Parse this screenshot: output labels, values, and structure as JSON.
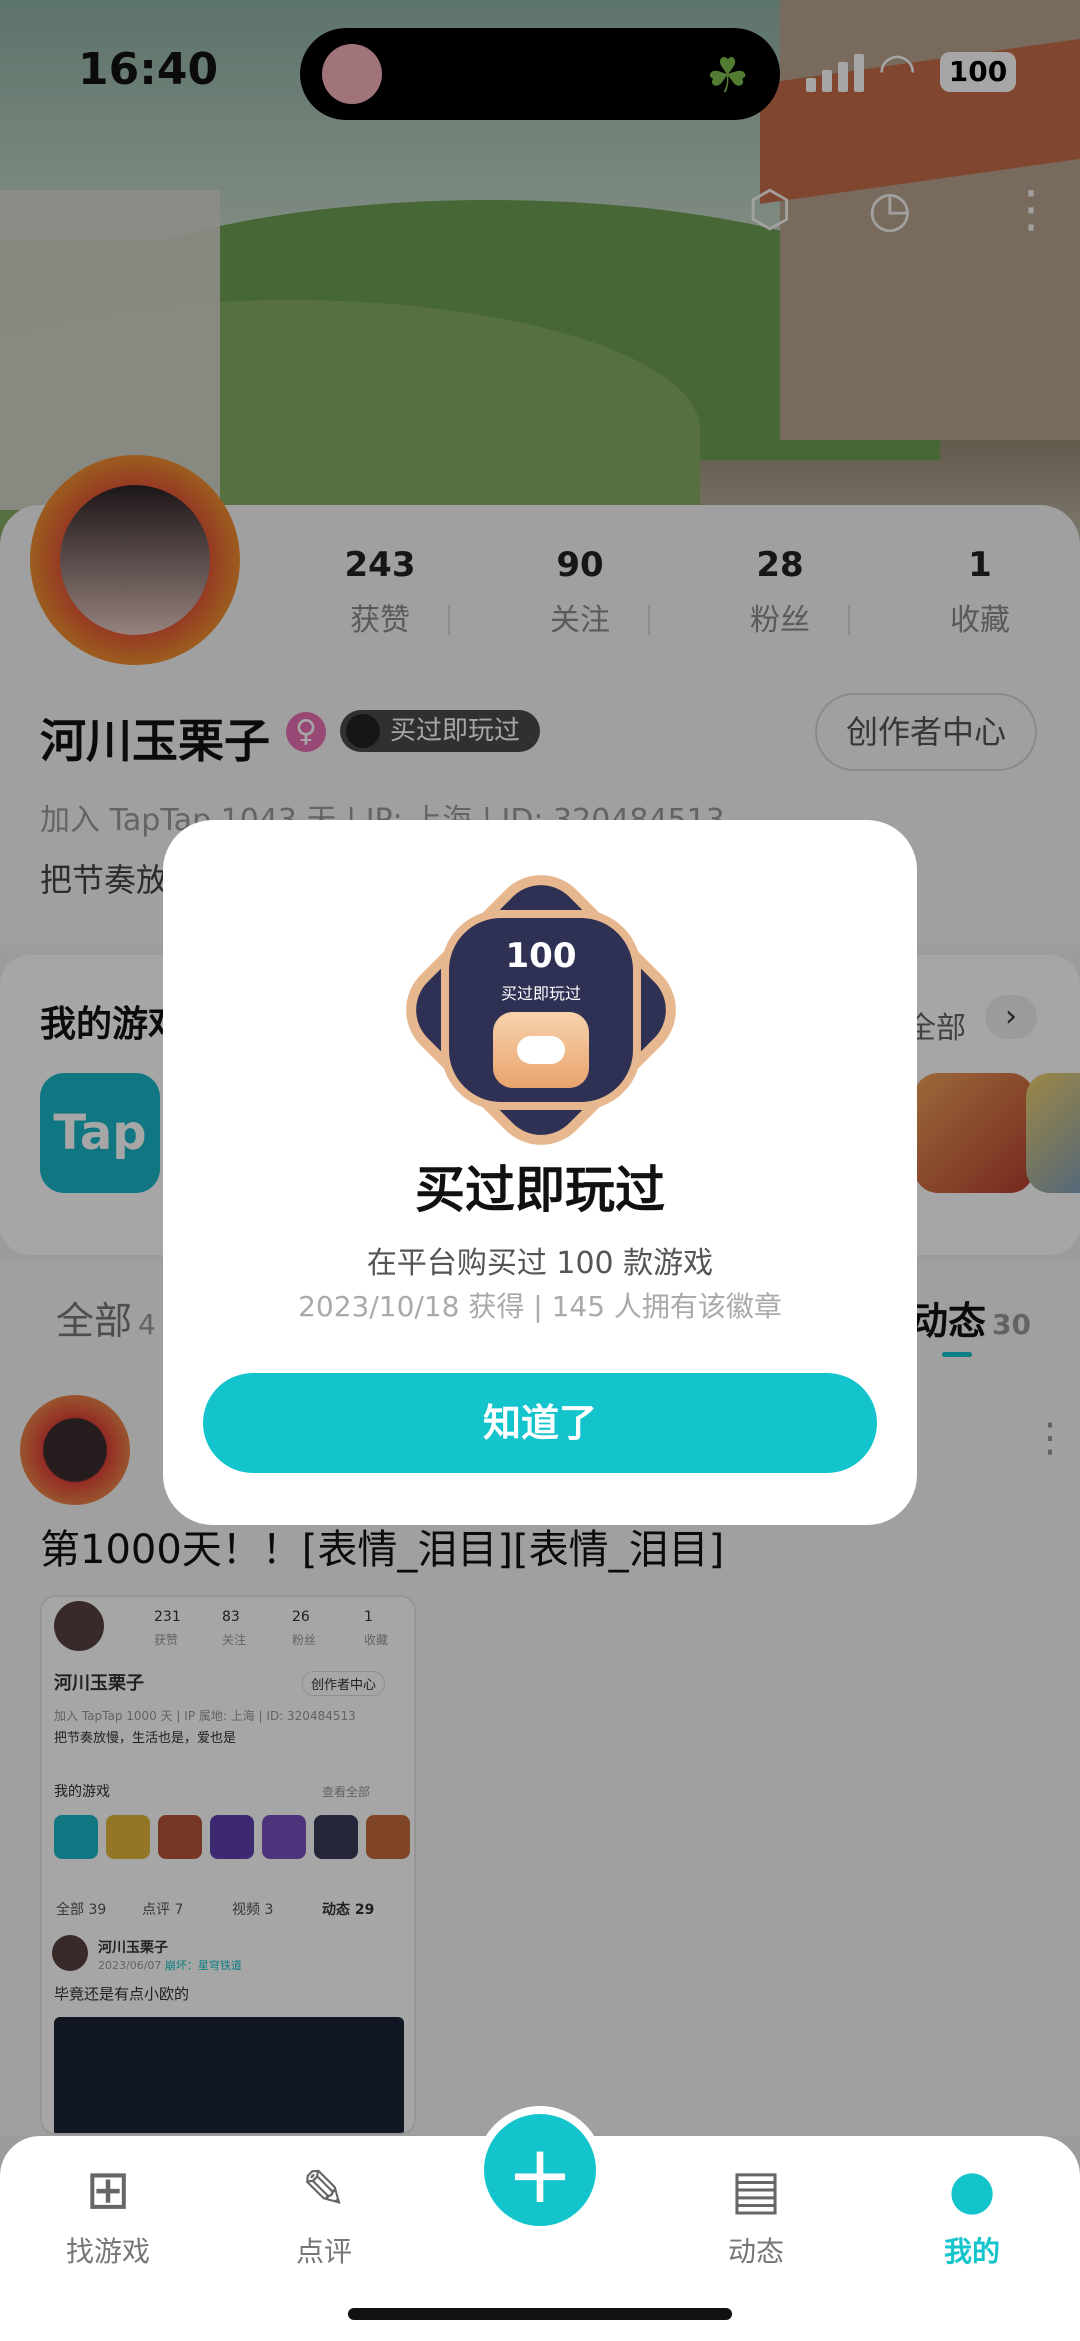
{
  "status_bar": {
    "time": "16:40",
    "battery": "100"
  },
  "profile": {
    "stats": [
      {
        "value": "243",
        "label": "获赞"
      },
      {
        "value": "90",
        "label": "关注"
      },
      {
        "value": "28",
        "label": "粉丝"
      },
      {
        "value": "1",
        "label": "收藏"
      }
    ],
    "name": "河川玉栗子",
    "gender_symbol": "♀",
    "medal_chip": "买过即玩过",
    "creator_button": "创作者中心",
    "meta": "加入 TapTap 1043 天 | IP: 上海 | ID: 320484513",
    "bio": "把节奏放"
  },
  "games": {
    "title": "我的游戏",
    "see_all": "全部",
    "first_game": "Tap"
  },
  "tabs": [
    {
      "label": "全部",
      "count": "4"
    },
    {
      "label": "动态",
      "count": "30"
    }
  ],
  "post": {
    "text": "第1000天！！[表情_泪目][表情_泪目]",
    "screenshot": {
      "stats": [
        {
          "value": "231",
          "label": "获赞"
        },
        {
          "value": "83",
          "label": "关注"
        },
        {
          "value": "26",
          "label": "粉丝"
        },
        {
          "value": "1",
          "label": "收藏"
        }
      ],
      "name": "河川玉栗子",
      "creator": "创作者中心",
      "meta": "加入 TapTap 1000 天 | IP 属地: 上海 | ID: 320484513",
      "bio": "把节奏放慢，生活也是，爱也是",
      "games_title": "我的游戏",
      "see_all": "查看全部",
      "tabs": [
        {
          "label": "全部",
          "count": "39"
        },
        {
          "label": "点评",
          "count": "7"
        },
        {
          "label": "视频",
          "count": "3"
        },
        {
          "label": "动态",
          "count": "29"
        }
      ],
      "post_name": "河川玉栗子",
      "post_date": "2023/06/07",
      "post_game": "崩坏：星穹铁道",
      "post_text": "毕竟还是有点小欧的"
    }
  },
  "modal": {
    "badge_number": "100",
    "badge_text": "买过即玩过",
    "title": "买过即玩过",
    "description": "在平台购买过 100 款游戏",
    "meta": "2023/10/18 获得 | 145 人拥有该徽章",
    "button": "知道了"
  },
  "nav": [
    {
      "label": "找游戏",
      "icon": "gamepad-icon"
    },
    {
      "label": "点评",
      "icon": "pen-icon"
    },
    {
      "label": "动态",
      "icon": "chat-icon"
    },
    {
      "label": "我的",
      "icon": "person-icon"
    }
  ],
  "colors": {
    "accent": "#14c4cc",
    "badge_dark": "#2e3154",
    "badge_gold": "#e7b88f"
  }
}
